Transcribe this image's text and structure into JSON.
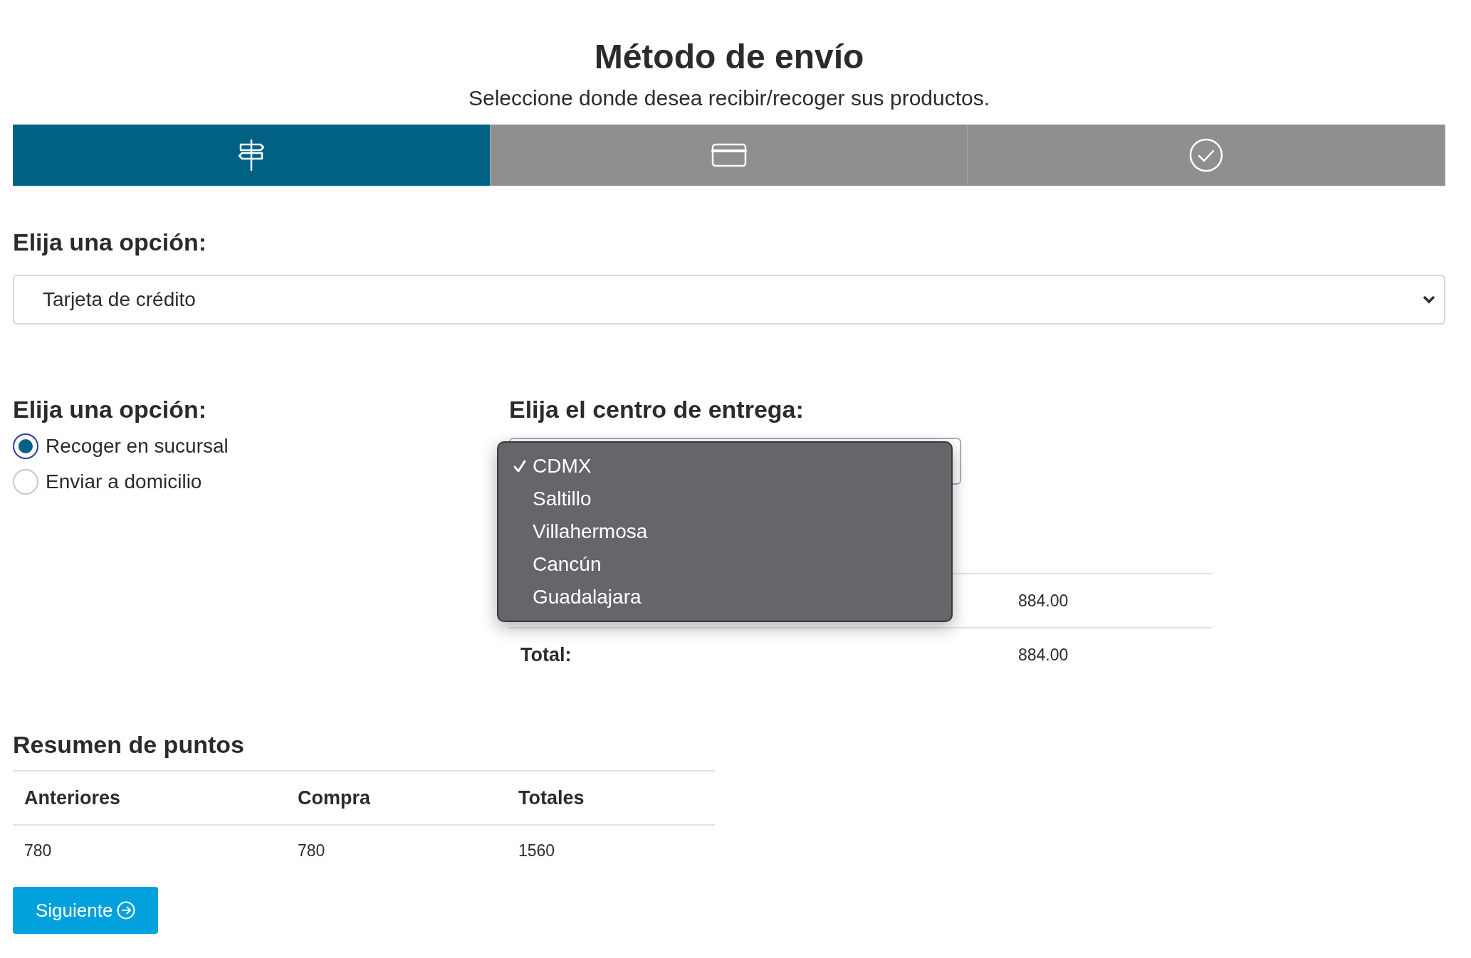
{
  "header": {
    "title": "Método de envío",
    "subtitle": "Seleccione donde desea recibir/recoger sus productos."
  },
  "steps": [
    {
      "kind": "signpost",
      "selected": true
    },
    {
      "kind": "card",
      "selected": false
    },
    {
      "kind": "check",
      "selected": false
    }
  ],
  "payment": {
    "label": "Elija una opción:",
    "value": "Tarjeta de crédito"
  },
  "delivery": {
    "label": "Elija una opción:",
    "options": [
      {
        "label": "Recoger en sucursal",
        "selected": true
      },
      {
        "label": "Enviar a domicilio",
        "selected": false
      }
    ]
  },
  "center": {
    "label": "Elija el centro de entrega:",
    "options": [
      {
        "label": "CDMX",
        "selected": true
      },
      {
        "label": "Saltillo",
        "selected": false
      },
      {
        "label": "Villahermosa",
        "selected": false
      },
      {
        "label": "Cancún",
        "selected": false
      },
      {
        "label": "Guadalajara",
        "selected": false
      }
    ]
  },
  "summary": {
    "rows": [
      {
        "value": "884.00"
      },
      {
        "label": "Total:",
        "value": "884.00"
      }
    ]
  },
  "points": {
    "title": "Resumen de puntos",
    "columns": [
      "Anteriores",
      "Compra",
      "Totales"
    ],
    "rows": [
      [
        "780",
        "780",
        "1560"
      ]
    ]
  },
  "next_button": "Siguiente"
}
